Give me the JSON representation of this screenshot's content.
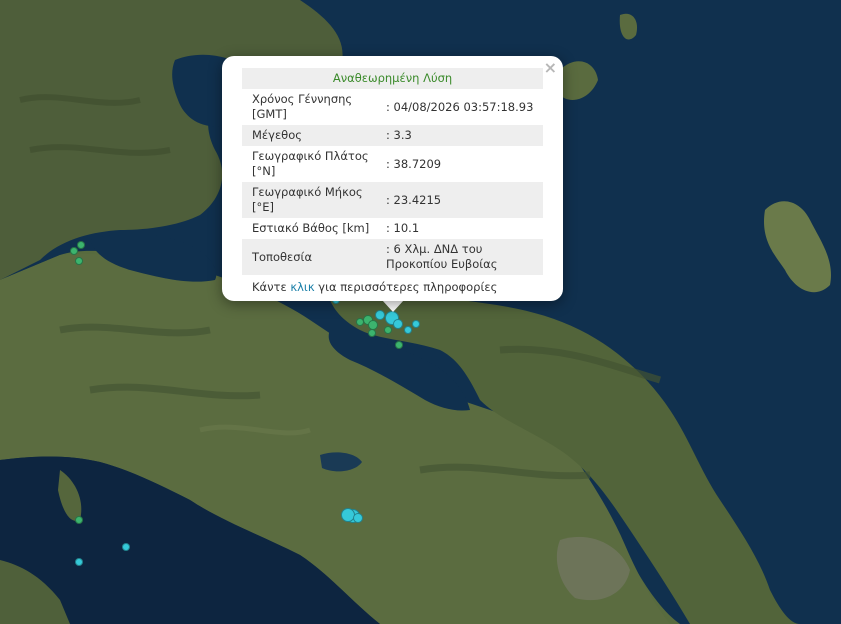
{
  "popup": {
    "title": "Αναθεωρημένη Λύση",
    "close_label": "×",
    "rows": [
      {
        "label": "Χρόνος Γέννησης [GMT]",
        "value": ": 04/08/2026 03:57:18.93"
      },
      {
        "label": "Μέγεθος",
        "value": ": 3.3"
      },
      {
        "label": "Γεωγραφικό Πλάτος [°N]",
        "value": ": 38.7209"
      },
      {
        "label": "Γεωγραφικό Μήκος [°E]",
        "value": ": 23.4215"
      },
      {
        "label": "Εστιακό Βάθος [km]",
        "value": ": 10.1"
      },
      {
        "label": "Τοποθεσία",
        "value": ": 6 Χλμ. ΔΝΔ του Προκοπίου Ευβοίας"
      }
    ],
    "more_prefix": "Κάντε ",
    "more_link": "κλικ",
    "more_suffix": " για περισσότερες πληροφορίες"
  },
  "colors": {
    "sea": "#0f2a44",
    "land": "#4a5a38",
    "marker_green": "#3cb46e",
    "marker_cyan": "#35c9d9",
    "link": "#1a7fa8",
    "title_green": "#3a8a2a"
  },
  "markers": [
    {
      "color": "cyan",
      "size": "large"
    },
    {
      "color": "cyan",
      "size": "medium"
    },
    {
      "color": "green",
      "size": "medium"
    },
    {
      "color": "green",
      "size": "medium"
    },
    {
      "color": "green",
      "size": "small"
    },
    {
      "color": "cyan",
      "size": "medium"
    },
    {
      "color": "cyan",
      "size": "small"
    },
    {
      "color": "green",
      "size": "small"
    },
    {
      "color": "cyan",
      "size": "small"
    },
    {
      "color": "green",
      "size": "small"
    },
    {
      "color": "green",
      "size": "small"
    },
    {
      "color": "cyan",
      "size": "large"
    },
    {
      "color": "cyan",
      "size": "large"
    },
    {
      "color": "cyan",
      "size": "medium"
    },
    {
      "color": "green",
      "size": "small"
    },
    {
      "color": "green",
      "size": "small"
    },
    {
      "color": "green",
      "size": "small"
    },
    {
      "color": "cyan",
      "size": "small"
    },
    {
      "color": "cyan",
      "size": "small"
    },
    {
      "color": "green",
      "size": "small"
    },
    {
      "color": "cyan",
      "size": "small"
    }
  ]
}
